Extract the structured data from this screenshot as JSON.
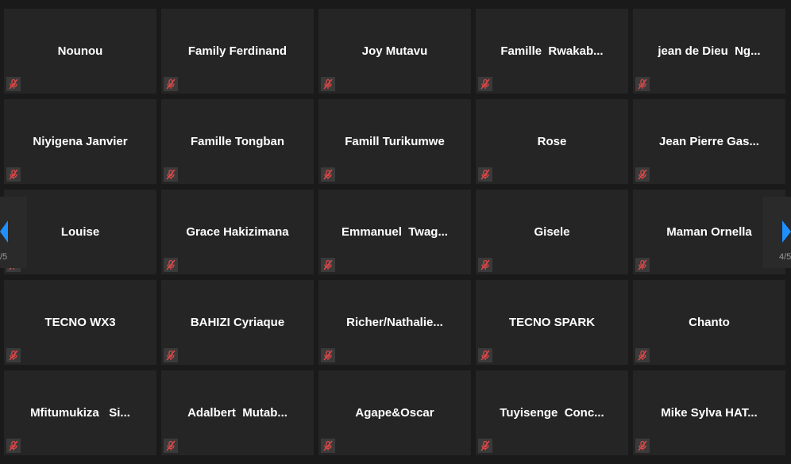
{
  "participants": [
    {
      "name": "Nounou"
    },
    {
      "name": "Family Ferdinand"
    },
    {
      "name": "Joy Mutavu"
    },
    {
      "name": "Famille  Rwakab..."
    },
    {
      "name": "jean de Dieu  Ng..."
    },
    {
      "name": "Niyigena Janvier"
    },
    {
      "name": "Famille Tongban"
    },
    {
      "name": "Famill Turikumwe"
    },
    {
      "name": "Rose"
    },
    {
      "name": "Jean Pierre Gas..."
    },
    {
      "name": "Louise"
    },
    {
      "name": "Grace Hakizimana"
    },
    {
      "name": "Emmanuel  Twag..."
    },
    {
      "name": "Gisele"
    },
    {
      "name": "Maman Ornella"
    },
    {
      "name": "TECNO WX3"
    },
    {
      "name": "BAHIZI Cyriaque"
    },
    {
      "name": "Richer/Nathalie..."
    },
    {
      "name": "TECNO SPARK"
    },
    {
      "name": "Chanto"
    },
    {
      "name": "Mfitumukiza   Si..."
    },
    {
      "name": "Adalbert  Mutab..."
    },
    {
      "name": "Agape&Oscar"
    },
    {
      "name": "Tuyisenge  Conc..."
    },
    {
      "name": "Mike Sylva HAT..."
    }
  ],
  "nav": {
    "left_page": "/5",
    "right_page": "4/5"
  },
  "colors": {
    "tile_bg": "#252525",
    "page_bg": "#1a1a1a",
    "nav_arrow": "#1e90ff",
    "mute_icon": "#e04848"
  },
  "icons": {
    "mute": "microphone-muted-icon",
    "prev": "chevron-left-icon",
    "next": "chevron-right-icon"
  }
}
